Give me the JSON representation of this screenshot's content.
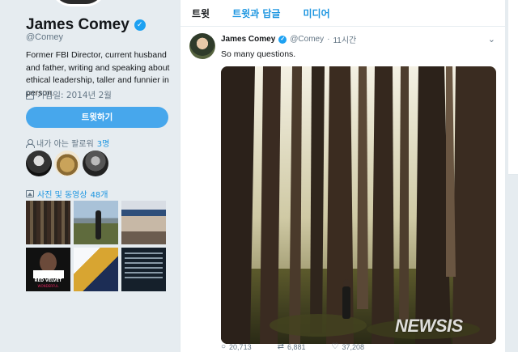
{
  "profile": {
    "name": "James Comey",
    "verified_mark": "✓",
    "handle": "@Comey",
    "bio": "Former FBI Director, current husband and father, writing and speaking about ethical leadership, taller and funnier in person.",
    "joined": "가입일: 2014년 2월",
    "tweet_button": "트윗하기",
    "followers_known_label": "내가 아는 팔로워",
    "followers_known_count": "3명",
    "media_label": "사진 및 동영상",
    "media_count": "48개",
    "media_thumb_label": "RED VELVET",
    "media_thumb_sub": "WONDERFUL"
  },
  "tabs": [
    {
      "label": "트윗",
      "active": true
    },
    {
      "label": "트윗과 답글",
      "active": false
    },
    {
      "label": "미디어",
      "active": false
    }
  ],
  "tweet": {
    "name": "James Comey",
    "handle": "@Comey",
    "separator": "·",
    "time": "11시간",
    "text": "So many questions.",
    "replies": "20,713",
    "retweets": "6,881",
    "likes": "37,208"
  },
  "watermark": "NEWSIS",
  "colors": {
    "accent": "#1da1f2",
    "link": "#1b95e0",
    "background": "#e6ecf0"
  },
  "icons": {
    "verified": "verified-badge-icon",
    "calendar": "calendar-icon",
    "person": "person-icon",
    "photo": "photo-icon",
    "chevron": "chevron-down-icon",
    "reply": "reply-icon",
    "retweet": "retweet-icon",
    "like": "heart-icon"
  }
}
